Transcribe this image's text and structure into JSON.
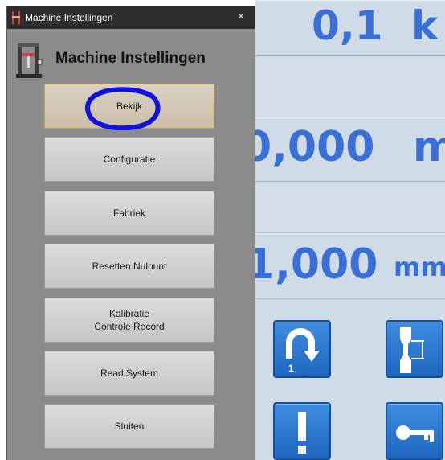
{
  "dialog": {
    "window_title": "Machine Instellingen",
    "heading": "Machine Instellingen",
    "close_glyph": "×",
    "buttons": {
      "bekijk": "Bekijk",
      "configuratie": "Configuratie",
      "fabriek": "Fabriek",
      "resetten": "Resetten Nulpunt",
      "kalibratie_line1": "Kalibratie",
      "kalibratie_line2": "Controle Record",
      "read_system": "Read System",
      "sluiten": "Sluiten"
    },
    "selected_button": "bekijk"
  },
  "background": {
    "readout1": {
      "value": "0,1",
      "unit": "k"
    },
    "readout2": {
      "value": "0,000",
      "unit": "m"
    },
    "readout3": {
      "value": "1,000",
      "unit": "mm"
    },
    "icon_badge": "1"
  },
  "colors": {
    "dialog_bg": "#8b8b8b",
    "titlebar": "#2d2d2d",
    "readout_text": "#3b6fd8",
    "app_button": "#2a78d2",
    "selection_border": "#c8a24a",
    "annotation_circle": "#1010e0"
  },
  "icons": [
    "window-app-icon",
    "close-icon",
    "tensile-tester-icon",
    "return-arrow-icon",
    "specimen-icon",
    "exclamation-icon",
    "key-icon"
  ]
}
